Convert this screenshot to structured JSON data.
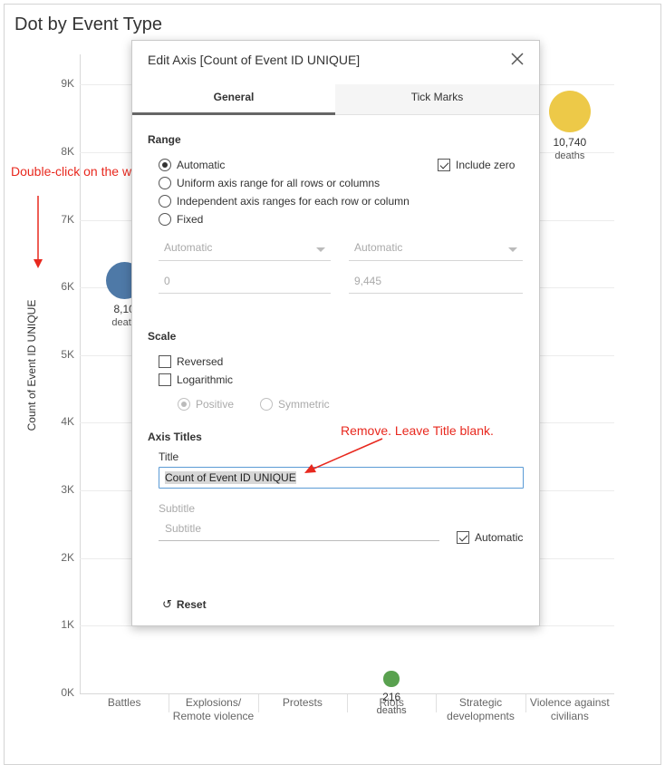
{
  "worksheet": {
    "title": "Dot by Event Type"
  },
  "chart_data": {
    "type": "scatter",
    "title": "Dot by Event Type",
    "ylabel": "Count of Event ID UNIQUE",
    "ylim": [
      0,
      9445
    ],
    "y_ticks": [
      "0K",
      "1K",
      "2K",
      "3K",
      "4K",
      "5K",
      "6K",
      "7K",
      "8K",
      "9K"
    ],
    "categories": [
      "Battles",
      "Explosions/\nRemote violence",
      "Protests",
      "Riots",
      "Strategic\ndevelopments",
      "Violence against\ncivilians"
    ],
    "points": [
      {
        "category": "Battles",
        "value": 6100,
        "label": "8,10",
        "unit": "death",
        "color": "#4e79a7"
      },
      {
        "category": "Riots",
        "value": 216,
        "label": "216",
        "unit": "deaths",
        "color": "#59a14f"
      },
      {
        "category": "Violence against\ncivilians",
        "value": 8600,
        "label": "10,740",
        "unit": "deaths",
        "color": "#edc948"
      }
    ]
  },
  "annotations": {
    "double_click": "Double-click on the white space here",
    "remove": "Remove. Leave Title blank."
  },
  "dialog": {
    "title": "Edit Axis [Count of Event ID UNIQUE]",
    "tabs": {
      "general": "General",
      "tick_marks": "Tick Marks"
    },
    "range": {
      "heading": "Range",
      "options": [
        "Automatic",
        "Uniform axis range for all rows or columns",
        "Independent axis ranges for each row or column",
        "Fixed"
      ],
      "selected": "Automatic",
      "include_zero": "Include zero",
      "start_dropdown": "Automatic",
      "end_dropdown": "Automatic",
      "start_value": "0",
      "end_value": "9,445"
    },
    "scale": {
      "heading": "Scale",
      "reversed": "Reversed",
      "logarithmic": "Logarithmic",
      "positive": "Positive",
      "symmetric": "Symmetric"
    },
    "axis_titles": {
      "heading": "Axis Titles",
      "title_label": "Title",
      "title_value": "Count of Event ID UNIQUE",
      "subtitle_label": "Subtitle",
      "subtitle_placeholder": "Subtitle",
      "automatic": "Automatic"
    },
    "reset": "Reset",
    "colors": {
      "annotation_red": "#e8281e",
      "focus_blue": "#5b9bd5"
    }
  }
}
